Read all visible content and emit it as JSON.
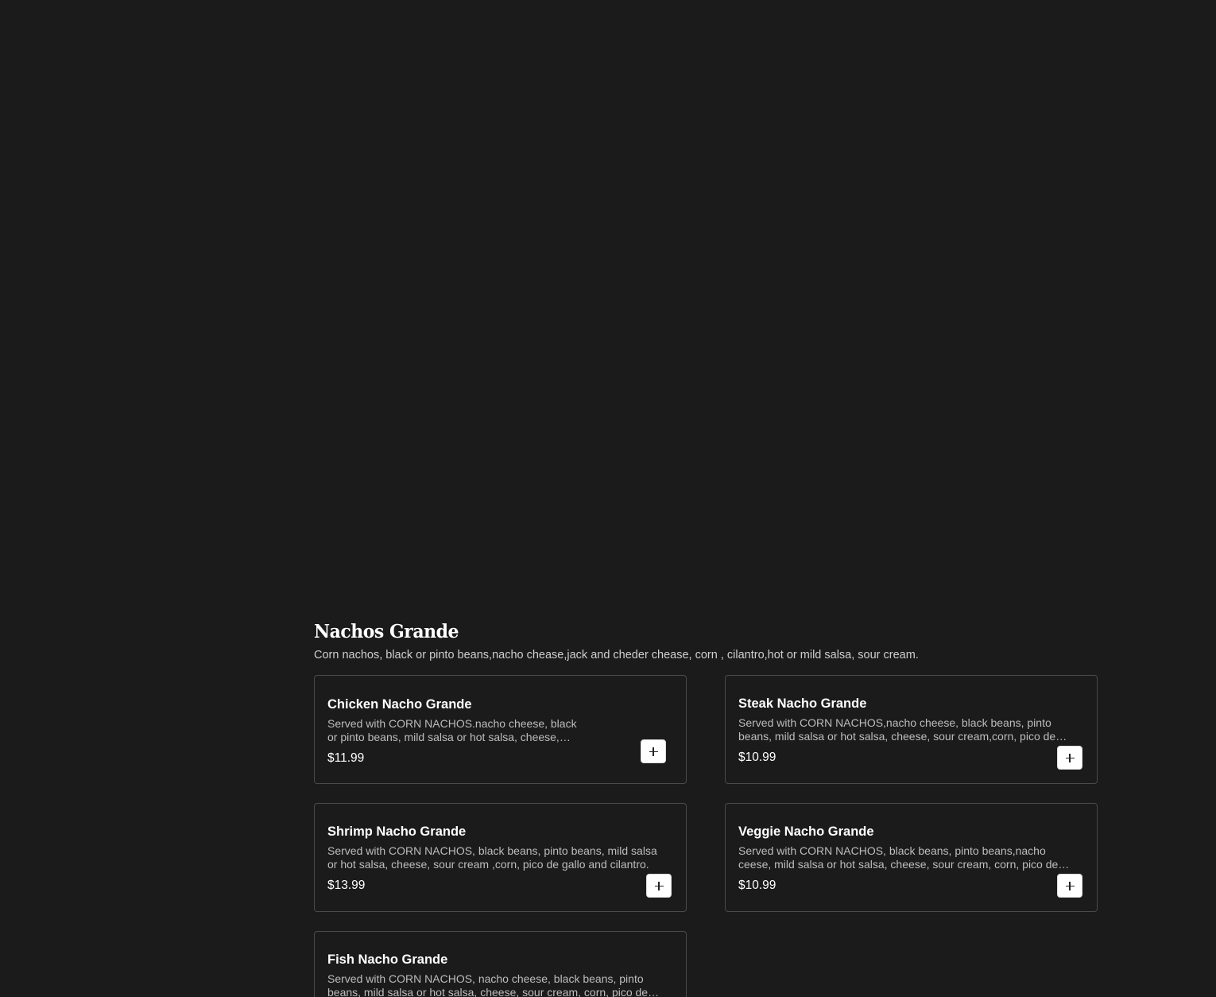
{
  "section": {
    "title": "Nachos Grande",
    "description": "Corn nachos, black or pinto beans,nacho chease,jack and cheder chease, corn , cilantro,hot or mild salsa, sour cream."
  },
  "items": [
    {
      "name": "Chicken Nacho Grande",
      "description": "Served with CORN NACHOS.nacho cheese, black or pinto beans, mild salsa or hot salsa, cheese, sour cream, corn, pico de gallo and cilantro.",
      "price": "$11.99"
    },
    {
      "name": "Steak Nacho Grande",
      "description": "Served with CORN NACHOS,nacho cheese, black beans, pinto beans, mild salsa or hot salsa, cheese, sour cream,corn, pico de gallo and cilantro.",
      "price": "$10.99"
    },
    {
      "name": "Shrimp Nacho Grande",
      "description": "Served with CORN NACHOS, black beans, pinto beans, mild salsa or hot salsa, cheese, sour cream ,corn, pico de gallo and cilantro.",
      "price": "$13.99"
    },
    {
      "name": "Veggie Nacho Grande",
      "description": "Served with CORN NACHOS, black beans, pinto beans,nacho ceese, mild salsa or hot salsa, cheese, sour cream, corn, pico de gallo and cilantro.",
      "price": "$10.99"
    },
    {
      "name": "Fish Nacho Grande",
      "description": "Served with CORN NACHOS, nacho cheese, black beans, pinto beans, mild salsa or hot salsa, cheese, sour cream, corn, pico de gallo and cilantro.",
      "price": ""
    }
  ],
  "icons": {
    "add": "plus-icon"
  }
}
